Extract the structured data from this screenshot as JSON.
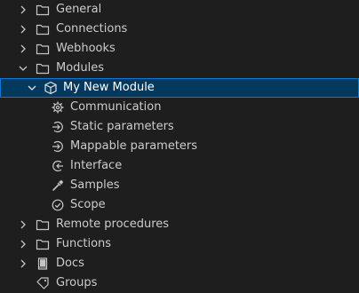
{
  "tree": {
    "items": [
      {
        "label": "General",
        "icon": "folder-icon",
        "state": "collapsed"
      },
      {
        "label": "Connections",
        "icon": "folder-icon",
        "state": "collapsed"
      },
      {
        "label": "Webhooks",
        "icon": "folder-icon",
        "state": "collapsed"
      },
      {
        "label": "Modules",
        "icon": "folder-icon",
        "state": "expanded"
      },
      {
        "label": "My New Module",
        "icon": "cube-icon",
        "state": "expanded",
        "selected": true
      },
      {
        "label": "Communication",
        "icon": "gear-icon"
      },
      {
        "label": "Static parameters",
        "icon": "parameter-icon"
      },
      {
        "label": "Mappable parameters",
        "icon": "parameter-icon"
      },
      {
        "label": "Interface",
        "icon": "interface-icon"
      },
      {
        "label": "Samples",
        "icon": "pipette-icon"
      },
      {
        "label": "Scope",
        "icon": "check-circle-icon"
      },
      {
        "label": "Remote procedures",
        "icon": "folder-icon",
        "state": "collapsed"
      },
      {
        "label": "Functions",
        "icon": "folder-icon",
        "state": "collapsed"
      },
      {
        "label": "Docs",
        "icon": "book-icon",
        "state": "collapsed"
      },
      {
        "label": "Groups",
        "icon": "tag-icon"
      }
    ]
  },
  "colors": {
    "background": "#1e1e1e",
    "selection": "#03395e",
    "selection_border": "#0a7ad6",
    "text": "#cccccc"
  }
}
